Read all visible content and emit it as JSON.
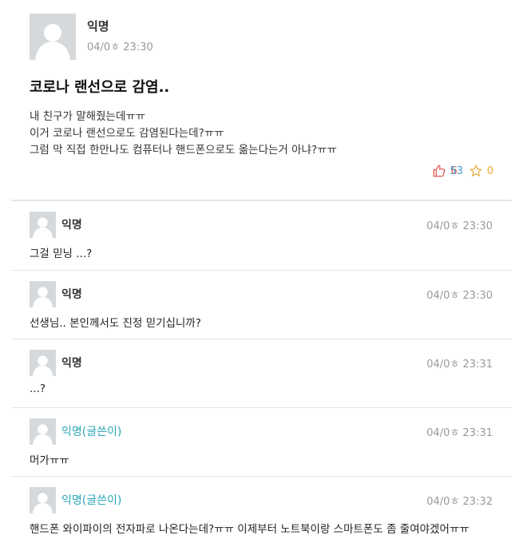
{
  "post": {
    "author": "익명",
    "time": "04/0ㅎ 23:30",
    "title": "코로나 랜선으로 감염..",
    "body": [
      "내 친구가 말해줬는데ㅠㅠ",
      "이거 코로나 랜선으로도 감염된다는데?ㅠㅠ",
      "그럼 막 직접 한만나도 컴퓨터나 핸드폰으로도 옮는다는거 아냐?ㅠㅠ"
    ],
    "likes": "6",
    "comments": "53",
    "stars": "0"
  },
  "comments": [
    {
      "author": "익명",
      "time": "04/0ㅎ 23:30",
      "text": "그걸 믿닝 ...?"
    },
    {
      "author": "익명",
      "time": "04/0ㅎ 23:30",
      "text": "선생님.. 본인께서도 진정 믿기십니까?"
    },
    {
      "author": "익명",
      "time": "04/0ㅎ 23:31",
      "text": "...?"
    },
    {
      "author": "익명(글쓴이)",
      "time": "04/0ㅎ 23:31",
      "text": "머가ㅠㅠ"
    },
    {
      "author": "익명(글쓴이)",
      "time": "04/0ㅎ 23:32",
      "text": "핸드폰 와이파이의 전자파로 나온다는데?ㅠㅠ 이제부터 노트북이랑 스마트폰도 좀 줄여야겠어ㅠㅠ"
    }
  ],
  "colors": {
    "like": "#e05a4d",
    "comment": "#4a9bd4",
    "star": "#e8a93a",
    "op_author": "#2aa6b7"
  }
}
